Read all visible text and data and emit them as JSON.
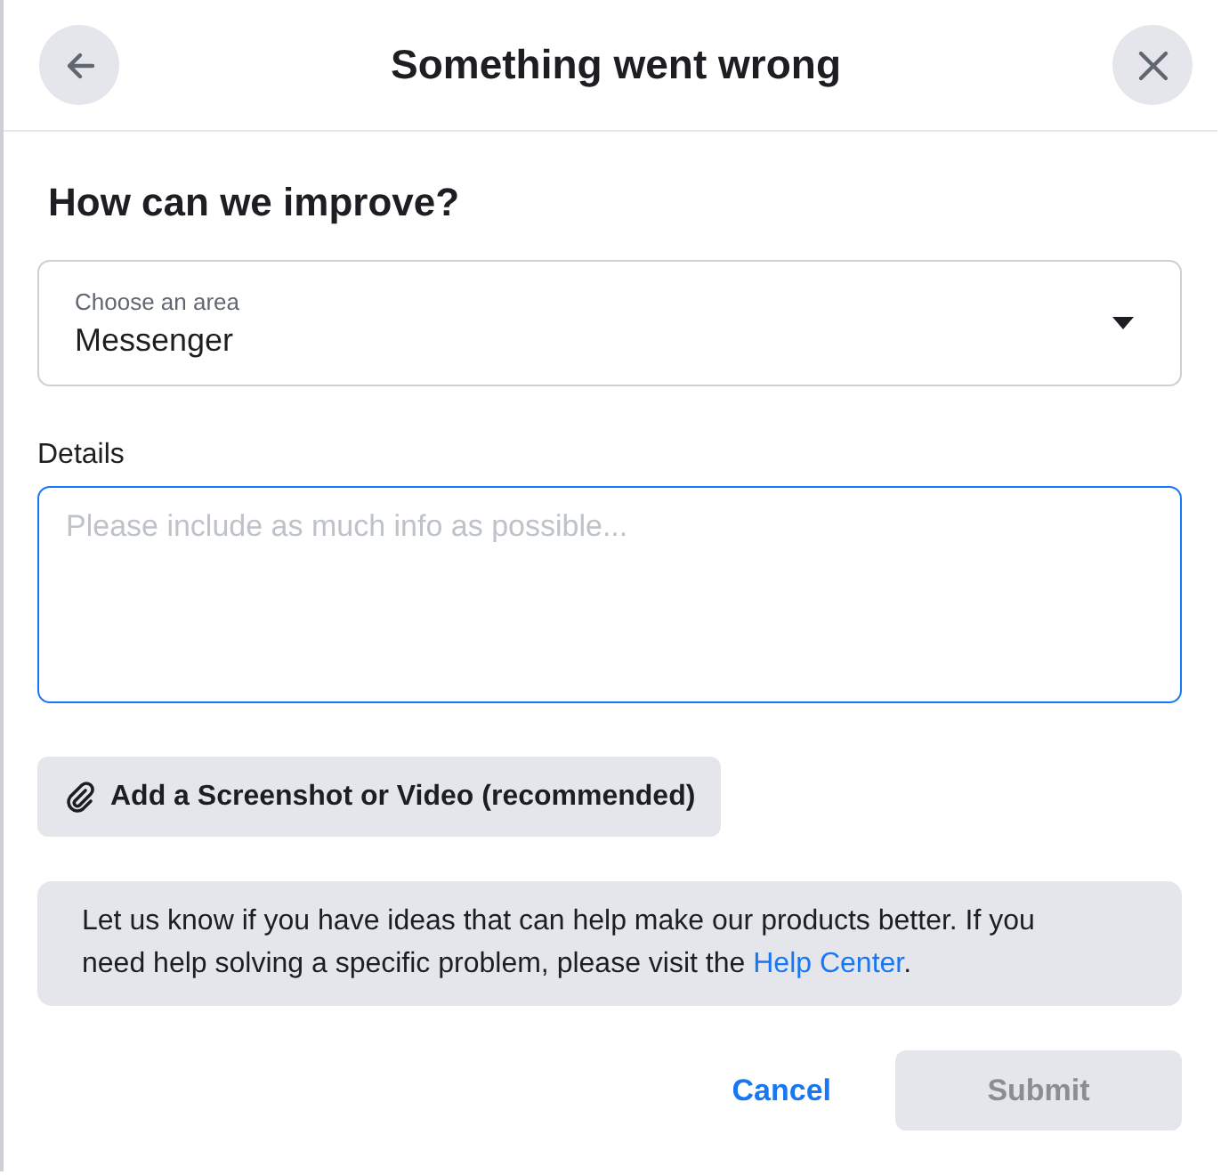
{
  "dialog": {
    "title": "Something went wrong"
  },
  "heading": "How can we improve?",
  "area_select": {
    "label": "Choose an area",
    "value": "Messenger"
  },
  "details": {
    "label": "Details",
    "placeholder": "Please include as much info as possible..."
  },
  "attach_button": {
    "label": "Add a Screenshot or Video (recommended)"
  },
  "info": {
    "text_before": "Let us know if you have ideas that can help make our products better. If you need help solving a specific problem, please visit the ",
    "link": "Help Center",
    "text_after": "."
  },
  "footer": {
    "cancel": "Cancel",
    "submit": {
      "label": "Submit",
      "disabled": true
    }
  }
}
